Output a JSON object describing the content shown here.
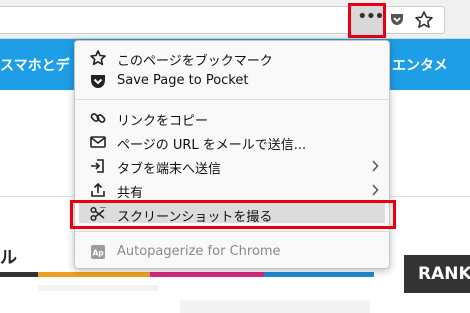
{
  "toolbar": {
    "page_actions_glyph": "•••",
    "pocket_icon": "pocket-icon",
    "bookmark_star_icon": "star-icon"
  },
  "page": {
    "nav_left": "スマホとデ",
    "nav_right": "エンタメ",
    "side_heading": "ル",
    "rank_label": "RANK",
    "colors": {
      "nav": "#1e9ee6",
      "highlight": "#e60012",
      "bar_colors": [
        "#333333",
        "#f0a020",
        "#d6287d",
        "#1e8ad6",
        "#7cc243"
      ]
    }
  },
  "menu": {
    "items": [
      {
        "label": "このページをブックマーク",
        "icon": "star-icon"
      },
      {
        "label": "Save Page to Pocket",
        "icon": "pocket-icon"
      },
      {
        "label": "リンクをコピー",
        "icon": "link-icon"
      },
      {
        "label": "ページの URL をメールで送信...",
        "icon": "mail-icon"
      },
      {
        "label": "タブを端末へ送信",
        "icon": "send-to-device-icon",
        "submenu": true
      },
      {
        "label": "共有",
        "icon": "share-icon",
        "submenu": true
      },
      {
        "label": "スクリーンショットを撮る",
        "icon": "scissors-icon",
        "selected": true
      },
      {
        "label": "Autopagerize for Chrome",
        "icon": "extension-icon",
        "disabled": true
      }
    ]
  }
}
